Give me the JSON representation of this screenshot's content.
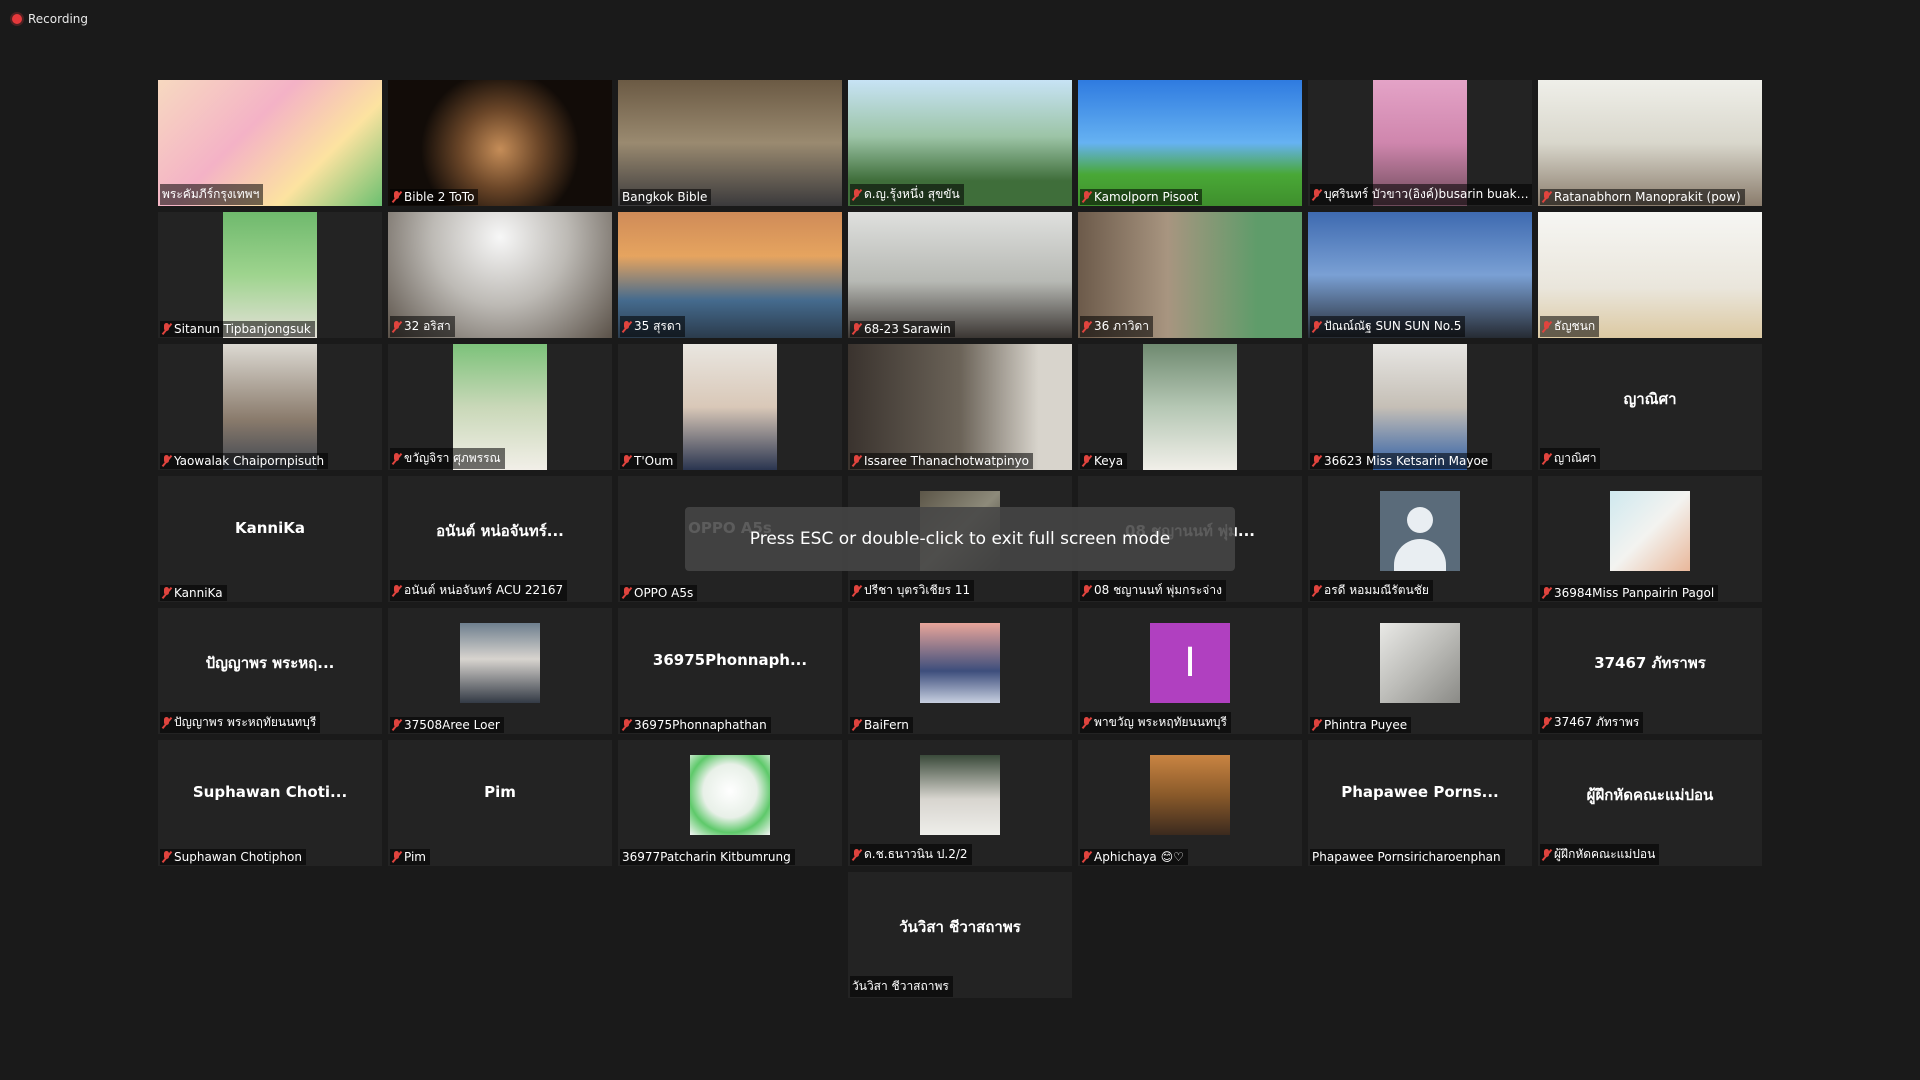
{
  "recording": {
    "label": "Recording"
  },
  "overlay": {
    "message": "Press ESC or double-click to exit full screen mode"
  },
  "tiles": [
    {
      "name": "พระคัมภีร์กรุงเทพฯ",
      "muted": false,
      "kind": "video",
      "bg": "linear-gradient(135deg,#f7d9c0,#f4b2c6 40%,#fce3a0 70%,#6cc070)"
    },
    {
      "name": "Bible 2 ToTo",
      "muted": true,
      "kind": "video",
      "bg": "radial-gradient(circle at 50% 55%,#c58d58 0,#6b4628 30%,#120c08 60%)"
    },
    {
      "name": "Bangkok Bible",
      "muted": false,
      "kind": "video",
      "active": true,
      "bg": "linear-gradient(180deg,#6b5a44,#9a8a70 50%,#3b3a3c)"
    },
    {
      "name": "ด.ญ.รุ้งหนึ่ง สุขขัน",
      "muted": true,
      "kind": "video",
      "bg": "linear-gradient(180deg,#c7e3f5 0,#9cc4a6 45%,#3f6e3a 80%)"
    },
    {
      "name": "Kamolporn Pisoot",
      "muted": true,
      "kind": "video",
      "bg": "linear-gradient(180deg,#2f7be0 0,#66b2f2 50%,#49a836 75%,#3f8f2d)"
    },
    {
      "name": "บุศรินทร์ บัวขาว(อิงค์)busarin buakh...",
      "muted": true,
      "kind": "video",
      "narrow": true,
      "bg": "linear-gradient(180deg,#e4a3c7,#cf86ad 50%,#6d4a5a)"
    },
    {
      "name": "Ratanabhorn Manoprakit (pow)",
      "muted": true,
      "kind": "video",
      "bg": "linear-gradient(180deg,#efefe9,#d9d7cc 50%,#8a7c6c)"
    },
    {
      "name": "Sitanun Tipbanjongsuk",
      "muted": true,
      "kind": "video",
      "narrow": true,
      "bg": "linear-gradient(180deg,#6fb96d,#9ed48e 50%,#e4e0d8)"
    },
    {
      "name": "32 อริสา",
      "muted": true,
      "kind": "video",
      "narrow": false,
      "bg": "radial-gradient(circle at 50% 20%,#f7f7f7 0,#bdbab5 45%,#5a5148)"
    },
    {
      "name": "35 สุรดา",
      "muted": true,
      "kind": "video",
      "bg": "linear-gradient(180deg,#cf8b58,#e6a45f 35%,#456b8e 70%,#2b3b4c)"
    },
    {
      "name": "68-23 Sarawin",
      "muted": true,
      "kind": "video",
      "bg": "linear-gradient(180deg,#dfe0de,#b7b9b4 55%,#3b3633)"
    },
    {
      "name": "36 ภาวิดา",
      "muted": true,
      "kind": "video",
      "bg": "linear-gradient(90deg,#6c5a4a,#a89580 40%,#5f9c6a 80%)"
    },
    {
      "name": "ปัณณ์ณัฐ SUN SUN No.5",
      "muted": true,
      "kind": "video",
      "bg": "linear-gradient(180deg,#3e6ab0,#7aa0d4 50%,#262b33)"
    },
    {
      "name": "ธัญชนก",
      "muted": true,
      "kind": "video",
      "bg": "linear-gradient(180deg,#f6f6f3,#eae6dc 60%,#dcc9a2)"
    },
    {
      "name": "Yaowalak Chaipornpisuth",
      "muted": true,
      "kind": "video",
      "narrow": true,
      "bg": "linear-gradient(180deg,#dcd9d2,#8a7b6c 60%,#3e4550)"
    },
    {
      "name": "ขวัญจิรา ศุภพรรณ",
      "muted": true,
      "kind": "video",
      "narrow": true,
      "bg": "linear-gradient(180deg,#7cc27a,#c9d8b8 50%,#f2efe8)"
    },
    {
      "name": "T'Oum",
      "muted": true,
      "kind": "video",
      "narrow": true,
      "bg": "linear-gradient(180deg,#e9e6e0,#d9c8b8 50%,#2a3550)"
    },
    {
      "name": "Issaree Thanachotwatpinyo",
      "muted": true,
      "kind": "video",
      "bg": "linear-gradient(90deg,#3a332e,#6b6358 50%,#d8d4cc 85%)"
    },
    {
      "name": "Keya",
      "muted": true,
      "kind": "video",
      "narrow": true,
      "bg": "linear-gradient(180deg,#6f8a70,#b5c7b4 50%,#f1efe9)"
    },
    {
      "name": "36623 Miss Ketsarin Mayoe",
      "muted": true,
      "kind": "video",
      "narrow": true,
      "bg": "linear-gradient(180deg,#e7e6e3,#c5bfb6 50%,#2f5fa6)"
    },
    {
      "name": "ญาณิศา",
      "muted": true,
      "kind": "name",
      "display": "ญาณิศา"
    },
    {
      "name": "KanniKa",
      "muted": true,
      "kind": "name",
      "display": "KanniKa"
    },
    {
      "name": "อนันต์ หน่อจันทร์ ACU 22167",
      "muted": true,
      "kind": "name",
      "display": "อนันต์ หน่อจันทร์..."
    },
    {
      "name": "OPPO A5s",
      "muted": true,
      "kind": "name",
      "display": "OPPO A5s"
    },
    {
      "name": "ปรีชา บุตรวิเชียร  11",
      "muted": true,
      "kind": "thumb",
      "thumbBg": "linear-gradient(135deg,#5c5648,#8d8a7a 50%,#2b2a24)"
    },
    {
      "name": "08 ชญานนท์ พุ่มกระจ่าง",
      "muted": true,
      "kind": "name",
      "display": "08 ชญานนท์ พุ่ม..."
    },
    {
      "name": "อรดี หอมมณีรัตนชัย",
      "muted": true,
      "kind": "default"
    },
    {
      "name": "36984Miss Panpairin Pagol",
      "muted": true,
      "kind": "thumb",
      "thumbBg": "linear-gradient(135deg,#cfe9ef,#f3f3f0 50%,#e9b79a)"
    },
    {
      "name": "ปัญญาพร พระหฤทัยนนทบุรี",
      "muted": true,
      "kind": "name",
      "display": "ปัญญาพร พระหฤ..."
    },
    {
      "name": "37508Aree Loer",
      "muted": true,
      "kind": "thumb",
      "thumbBg": "linear-gradient(180deg,#6e7f8e,#d8d4cf 45%,#333a45)"
    },
    {
      "name": "36975Phonnaphathan",
      "muted": true,
      "kind": "name",
      "display": "36975Phonnaph..."
    },
    {
      "name": "BaiFern",
      "muted": true,
      "kind": "thumb",
      "thumbBg": "linear-gradient(180deg,#e8a59a,#3d4e7c 60%,#c7cfe0)"
    },
    {
      "name": "พาขวัญ พระหฤทัยนนทบุรี",
      "muted": true,
      "kind": "letter",
      "letter": "I"
    },
    {
      "name": "Phintra Puyee",
      "muted": true,
      "kind": "thumb",
      "thumbBg": "linear-gradient(135deg,#e9e9e6,#bcbcb8 50%,#8a8a86)"
    },
    {
      "name": "37467 ภัทราพร",
      "muted": true,
      "kind": "name",
      "display": "37467 ภัทราพร"
    },
    {
      "name": "Suphawan Chotiphon",
      "muted": true,
      "kind": "name",
      "display": "Suphawan  Choti..."
    },
    {
      "name": "Pim",
      "muted": true,
      "kind": "name",
      "display": "Pim"
    },
    {
      "name": "36977Patcharin Kitbumrung",
      "muted": false,
      "kind": "thumb",
      "thumbBg": "radial-gradient(circle at 50% 45%,#ffffff 0,#e8f0e8 45%,#5ec96a 70%,#f5f5f5)"
    },
    {
      "name": "ด.ช.ธนาวนิน ป.2/2",
      "muted": true,
      "kind": "thumb",
      "thumbBg": "linear-gradient(180deg,#3a4a3a,#d8d5cf 55%,#eeeeea)"
    },
    {
      "name": "Aphichaya 😊♡",
      "muted": true,
      "kind": "thumb",
      "thumbBg": "linear-gradient(180deg,#c98442,#8a5a2a 50%,#3b2a1e)"
    },
    {
      "name": "Phapawee Pornsiricharoenphan",
      "muted": false,
      "kind": "name",
      "display": "Phapawee  Porns..."
    },
    {
      "name": "ผู้ฝึกหัดคณะแม่ปอน",
      "muted": true,
      "kind": "name",
      "display": "ผู้ฝึกหัดคณะแม่ปอน"
    },
    {
      "name": "วันวิสา ชีวาสถาพร",
      "muted": false,
      "kind": "name",
      "display": "วันวิสา ชีวาสถาพร",
      "last": true
    }
  ]
}
